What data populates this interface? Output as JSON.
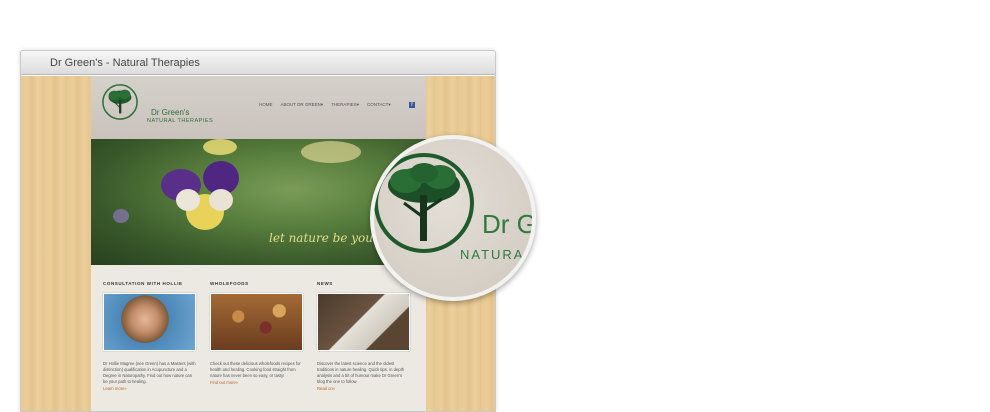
{
  "window": {
    "title": "Dr Green's - Natural Therapies"
  },
  "site": {
    "brand_line1": "Dr Green's",
    "brand_line2": "NATURAL THERAPIES",
    "nav": [
      {
        "label": "HOME"
      },
      {
        "label": "ABOUT DR GREEN▾"
      },
      {
        "label": "THERAPIES▾"
      },
      {
        "label": "CONTACT▾"
      }
    ],
    "facebook_icon": "facebook-icon",
    "hero_tagline": "let nature be your c",
    "columns": [
      {
        "heading": "CONSULTATION WITH HOLLIE",
        "text": "Dr Hollie Magree (nee Green) has a Masters (with distinction) qualification in Acupuncture and a Degree in Naturopathy. Find out how nature can be your path to healing.",
        "link": "Learn more»"
      },
      {
        "heading": "WHOLEFOODS",
        "text": "Check out these delicious wholefoods recipes for health and healing. Cooking food straight from nature has never been so easy, or tasty!",
        "link": "Find out more»"
      },
      {
        "heading": "NEWS",
        "text": "Discover the latest science and the oldest traditions in nature healing. Quick tips, in depth analysis and a bit of humour make Dr Green's blog the one to follow.",
        "link": "Read on»"
      }
    ]
  },
  "magnifier": {
    "text1": "Dr G",
    "text2": "NATURA"
  },
  "colors": {
    "brand_green": "#2d6f3a",
    "link_orange": "#b8672a",
    "wood": "#e8c993"
  }
}
